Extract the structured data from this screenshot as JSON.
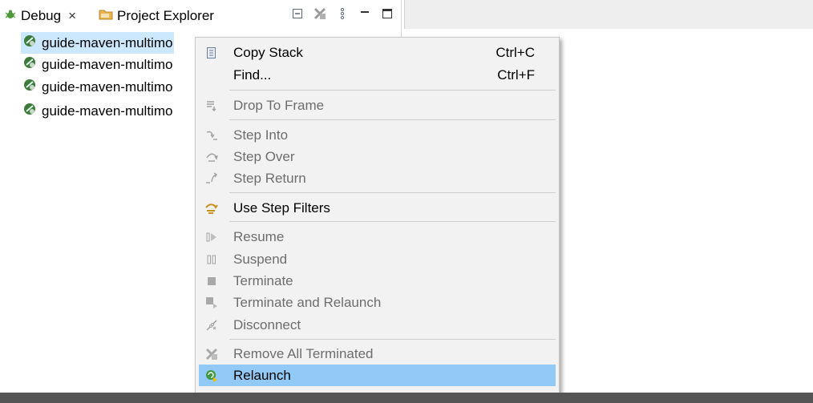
{
  "tabs": [
    {
      "label": "Debug",
      "close": "×"
    },
    {
      "label": "Project Explorer"
    }
  ],
  "tree": {
    "items": [
      {
        "label": "guide-maven-multimo",
        "selected": true
      },
      {
        "label": "guide-maven-multimo",
        "selected": false
      },
      {
        "label": "guide-maven-multimo",
        "selected": false
      },
      {
        "label": "guide-maven-multimo",
        "selected": false
      }
    ]
  },
  "menu": {
    "copy_stack": {
      "label": "Copy Stack",
      "shortcut": "Ctrl+C"
    },
    "find": {
      "label": "Find...",
      "shortcut": "Ctrl+F"
    },
    "drop_to_frame": {
      "label": "Drop To Frame"
    },
    "step_into": {
      "label": "Step Into"
    },
    "step_over": {
      "label": "Step Over"
    },
    "step_return": {
      "label": "Step Return"
    },
    "use_step_filters": {
      "label": "Use Step Filters"
    },
    "resume": {
      "label": "Resume"
    },
    "suspend": {
      "label": "Suspend"
    },
    "terminate": {
      "label": "Terminate"
    },
    "terminate_relaunch": {
      "label": "Terminate and Relaunch"
    },
    "disconnect": {
      "label": "Disconnect"
    },
    "remove_all_terminated": {
      "label": "Remove All Terminated"
    },
    "relaunch": {
      "label": "Relaunch"
    }
  },
  "colors": {
    "selection": "#cce8ff",
    "menu_highlight": "#91c9f7",
    "menu_bg": "#f2f2f2",
    "disabled_text": "#6d6d6d"
  },
  "icons": [
    "debug-bug-icon",
    "folder-icon",
    "collapse-all-icon",
    "remove-terminated-icon",
    "view-menu-icon",
    "minimize-icon",
    "maximize-icon",
    "launch-icon",
    "copy-icon",
    "drop-frame-icon",
    "step-into-icon",
    "step-over-icon",
    "step-return-icon",
    "step-filters-icon",
    "resume-icon",
    "suspend-icon",
    "terminate-icon",
    "terminate-relaunch-icon",
    "disconnect-icon",
    "remove-all-terminated-icon",
    "relaunch-icon"
  ]
}
